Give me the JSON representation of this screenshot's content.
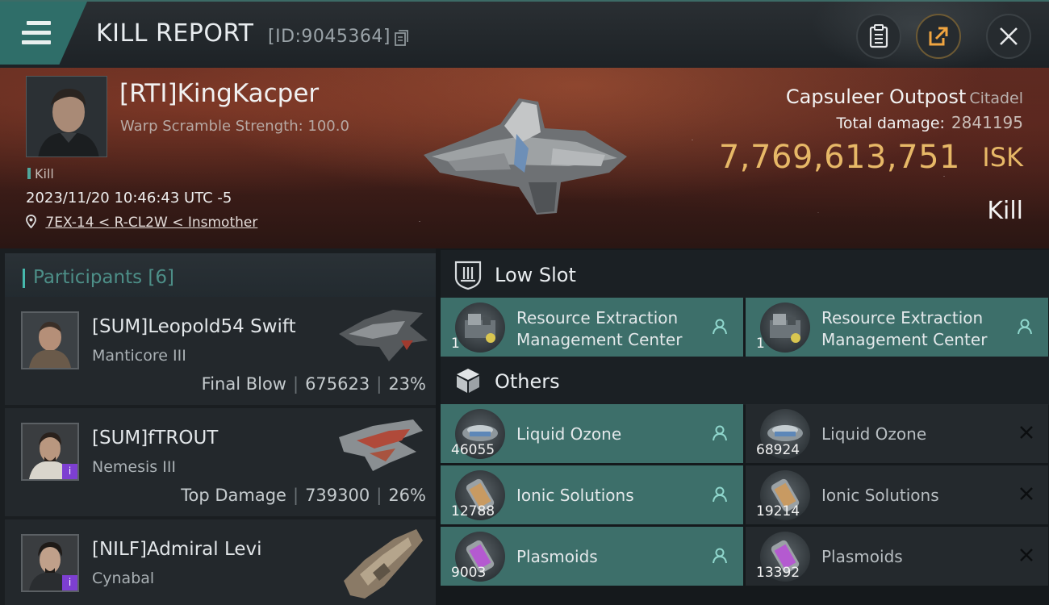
{
  "header": {
    "title": "KILL REPORT",
    "id_label": "[ID:9045364]"
  },
  "victim": {
    "name": "[RTI]KingKacper",
    "subline": "Warp Scramble Strength: 100.0",
    "kill_tag": "Kill",
    "datetime": "2023/11/20 10:46:43 UTC -5",
    "location": "7EX-14 < R-CL2W < Insmother"
  },
  "target": {
    "name": "Capsuleer Outpost",
    "class": "Citadel",
    "total_damage_label": "Total damage:",
    "total_damage_value": "2841195",
    "isk_value": "7,769,613,751",
    "isk_unit": "ISK",
    "result": "Kill"
  },
  "participants": {
    "label": "Participants",
    "count": "[6]",
    "items": [
      {
        "name": "[SUM]Leopold54 Swift",
        "ship": "Manticore III",
        "role": "Final Blow",
        "damage": "675623",
        "percent": "23%",
        "badge": false
      },
      {
        "name": "[SUM]fTROUT",
        "ship": "Nemesis III",
        "role": "Top Damage",
        "damage": "739300",
        "percent": "26%",
        "badge": true
      },
      {
        "name": "[NILF]Admiral Levi",
        "ship": "Cynabal",
        "role": "",
        "damage": "",
        "percent": "",
        "badge": true
      }
    ]
  },
  "sections": {
    "low_slot": "Low Slot",
    "others": "Others"
  },
  "low_slot_items": [
    {
      "name_line1": "Resource Extraction",
      "name_line2": "Management Center",
      "qty": "1"
    },
    {
      "name_line1": "Resource Extraction",
      "name_line2": "Management Center",
      "qty": "1"
    }
  ],
  "other_items": [
    {
      "name": "Liquid Ozone",
      "qty": "46055"
    },
    {
      "name": "Liquid Ozone",
      "qty": "68924"
    },
    {
      "name": "Ionic Solutions",
      "qty": "12788"
    },
    {
      "name": "Ionic Solutions",
      "qty": "19214"
    },
    {
      "name": "Plasmoids",
      "qty": "9003"
    },
    {
      "name": "Plasmoids",
      "qty": "13392"
    }
  ],
  "colors": {
    "accent": "#3d6f6a",
    "isk": "#e7b867",
    "participants_label": "#4d8f88"
  }
}
